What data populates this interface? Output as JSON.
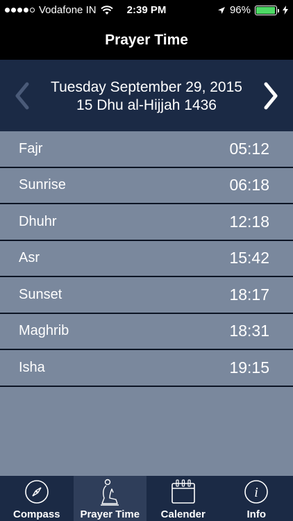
{
  "status_bar": {
    "carrier": "Vodafone IN",
    "time": "2:39 PM",
    "battery": "96%",
    "battery_level": 0.96,
    "icons": [
      "signal-dots-icon",
      "wifi-icon",
      "location-arrow-icon",
      "battery-icon",
      "charging-bolt-icon"
    ]
  },
  "nav": {
    "title": "Prayer Time"
  },
  "date_header": {
    "gregorian": "Tuesday September 29, 2015",
    "hijri": "15 Dhu al-Hijjah 1436",
    "prev_icon": "chevron-left-icon",
    "next_icon": "chevron-right-icon"
  },
  "prayers": [
    {
      "name": "Fajr",
      "time": "05:12"
    },
    {
      "name": "Sunrise",
      "time": "06:18"
    },
    {
      "name": "Dhuhr",
      "time": "12:18"
    },
    {
      "name": "Asr",
      "time": "15:42"
    },
    {
      "name": "Sunset",
      "time": "18:17"
    },
    {
      "name": "Maghrib",
      "time": "18:31"
    },
    {
      "name": "Isha",
      "time": "19:15"
    }
  ],
  "tabs": [
    {
      "label": "Compass",
      "icon": "compass-icon"
    },
    {
      "label": "Prayer Time",
      "icon": "praying-person-icon",
      "selected": true
    },
    {
      "label": "Calender",
      "icon": "calendar-icon"
    },
    {
      "label": "Info",
      "icon": "info-icon"
    }
  ],
  "colors": {
    "header_bg": "#1b2a45",
    "list_bg": "#7a889d",
    "separator": "#0c1424",
    "tab_active_bg": "#2f3e5a",
    "battery_fill": "#4cd964"
  }
}
